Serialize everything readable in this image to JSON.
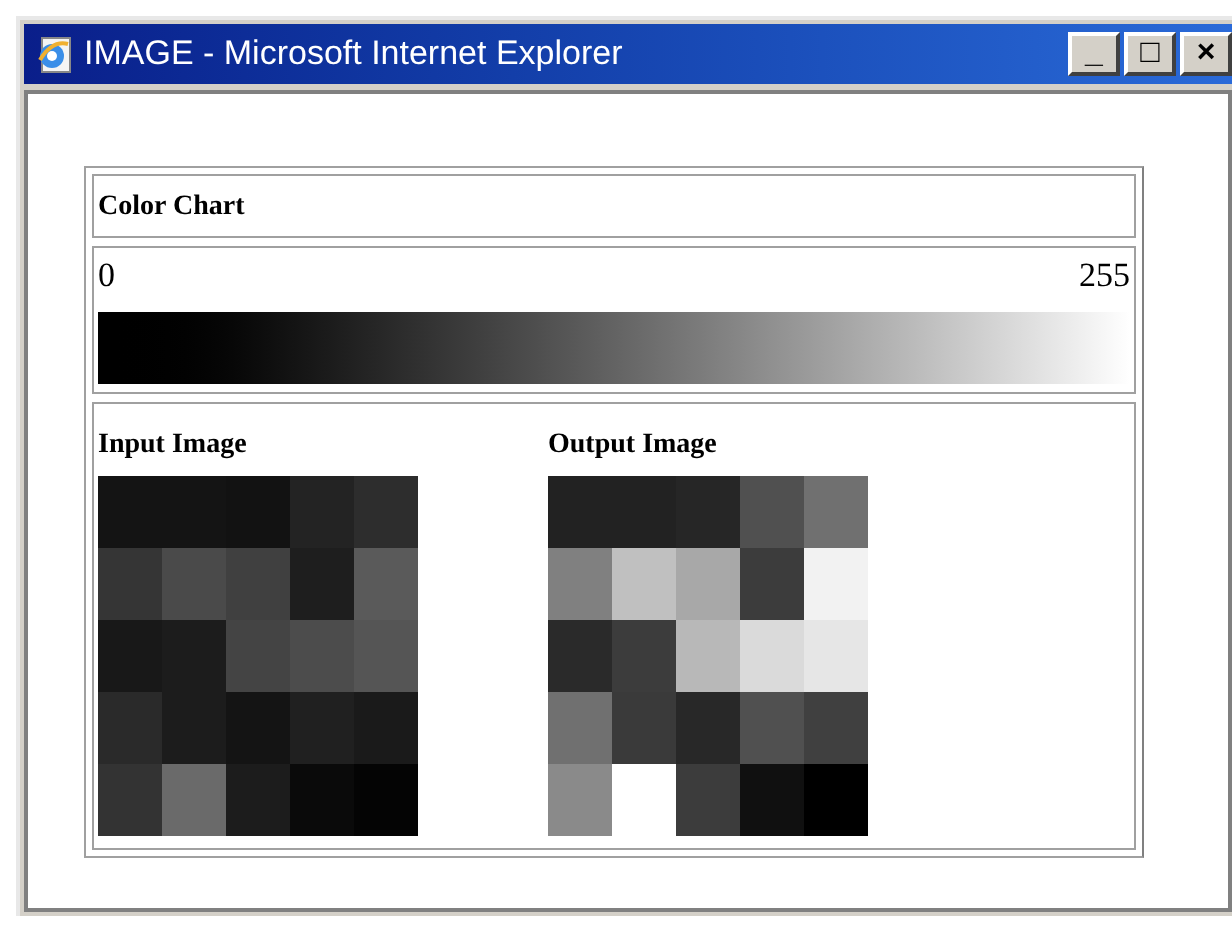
{
  "window": {
    "title": "IMAGE - Microsoft Internet Explorer",
    "controls": [
      "_",
      "□",
      "×"
    ]
  },
  "color_chart": {
    "title": "Color Chart",
    "min_label": "0",
    "max_label": "255"
  },
  "images": [
    {
      "title": "Input Image",
      "rows": [
        [
          {
            "color": "#141414"
          },
          {
            "color": "#141414"
          },
          {
            "color": "#121212"
          },
          {
            "color": "#232323"
          },
          {
            "color": "#2d2d2d"
          }
        ],
        [
          {
            "color": "#353535"
          },
          {
            "color": "#4a4a4a"
          },
          {
            "color": "#404040"
          },
          {
            "color": "#1e1e1e"
          },
          {
            "color": "#5a5a5a"
          }
        ],
        [
          {
            "color": "#181818"
          },
          {
            "color": "#1c1c1c"
          },
          {
            "color": "#444444"
          },
          {
            "color": "#4c4c4c"
          },
          {
            "color": "#555555"
          }
        ],
        [
          {
            "color": "#2a2a2a"
          },
          {
            "color": "#1c1c1c"
          },
          {
            "color": "#141414"
          },
          {
            "color": "#202020"
          },
          {
            "color": "#1a1a1a"
          }
        ],
        [
          {
            "color": "#333333"
          },
          {
            "color": "#6a6a6a"
          },
          {
            "color": "#1c1c1c"
          },
          {
            "color": "#0a0a0a"
          },
          {
            "color": "#040404"
          }
        ]
      ]
    },
    {
      "title": "Output Image",
      "rows": [
        [
          {
            "color": "#222222"
          },
          {
            "color": "#222222"
          },
          {
            "color": "#262626"
          },
          {
            "color": "#505050"
          },
          {
            "color": "#707070"
          }
        ],
        [
          {
            "color": "#808080"
          },
          {
            "color": "#c0c0c0"
          },
          {
            "color": "#a8a8a8"
          },
          {
            "color": "#3c3c3c"
          },
          {
            "color": "#f2f2f2"
          }
        ],
        [
          {
            "color": "#2a2a2a"
          },
          {
            "color": "#3c3c3c"
          },
          {
            "color": "#b8b8b8"
          },
          {
            "color": "#dadada"
          },
          {
            "color": "#e6e6e6"
          }
        ],
        [
          {
            "color": "#707070"
          },
          {
            "color": "#3a3a3a"
          },
          {
            "color": "#282828"
          },
          {
            "color": "#505050"
          },
          {
            "color": "#404040"
          }
        ],
        [
          {
            "color": "#8a8a8a"
          },
          {
            "color": "#ffffff"
          },
          {
            "color": "#3c3c3c"
          },
          {
            "color": "#101010"
          },
          {
            "color": "#000000"
          }
        ]
      ]
    }
  ]
}
